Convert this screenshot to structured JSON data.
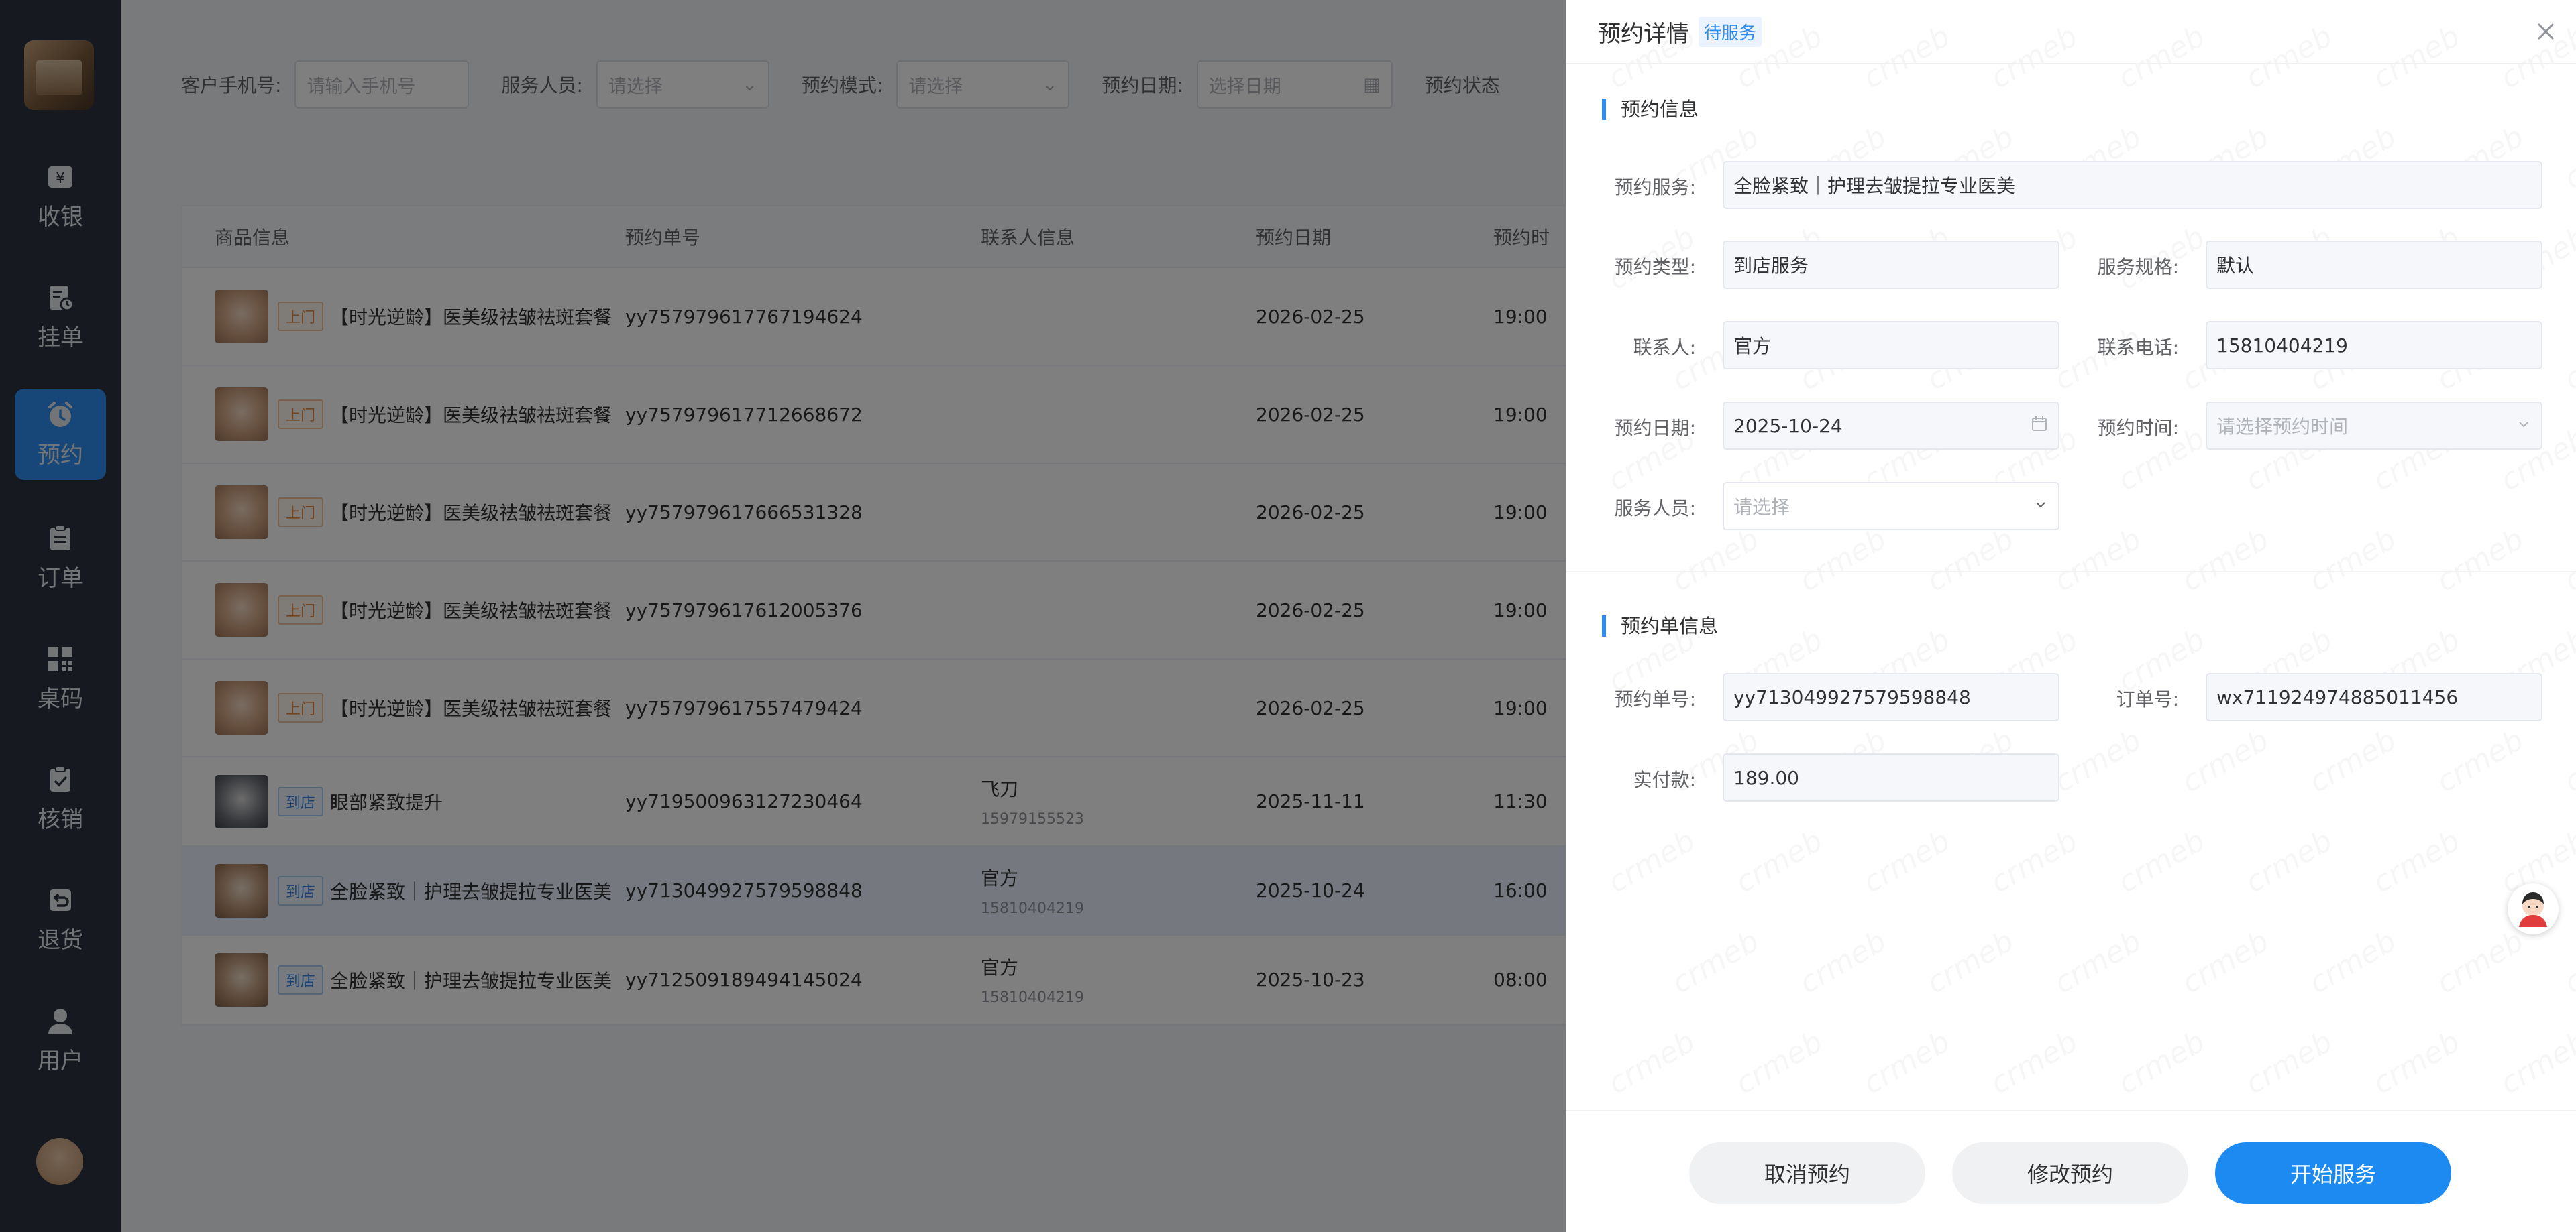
{
  "sidebar": {
    "items": [
      {
        "label": "收银",
        "icon": "cashier-icon"
      },
      {
        "label": "挂单",
        "icon": "pending-order-icon"
      },
      {
        "label": "预约",
        "icon": "alarm-clock-icon"
      },
      {
        "label": "订单",
        "icon": "clipboard-icon"
      },
      {
        "label": "桌码",
        "icon": "qr-code-icon"
      },
      {
        "label": "核销",
        "icon": "verify-icon"
      },
      {
        "label": "退货",
        "icon": "return-icon"
      },
      {
        "label": "用户",
        "icon": "user-icon"
      }
    ],
    "active": "预约"
  },
  "filters": {
    "phone_label": "客户手机号:",
    "phone_placeholder": "请输入手机号",
    "staff_label": "服务人员:",
    "staff_placeholder": "请选择",
    "mode_label": "预约模式:",
    "mode_placeholder": "请选择",
    "date_label": "预约日期:",
    "date_placeholder": "选择日期",
    "status_label": "预约状态"
  },
  "table": {
    "headers": {
      "goods": "商品信息",
      "order_no": "预约单号",
      "contact": "联系人信息",
      "date": "预约日期",
      "time": "预约时"
    },
    "rows": [
      {
        "tag": "上门",
        "goods": "【时光逆龄】医美级祛皱祛斑套餐",
        "order_no": "yy757979617767194624",
        "contact_name": "",
        "contact_phone": "",
        "date": "2026-02-25",
        "time": "19:00"
      },
      {
        "tag": "上门",
        "goods": "【时光逆龄】医美级祛皱祛斑套餐",
        "order_no": "yy757979617712668672",
        "contact_name": "",
        "contact_phone": "",
        "date": "2026-02-25",
        "time": "19:00"
      },
      {
        "tag": "上门",
        "goods": "【时光逆龄】医美级祛皱祛斑套餐",
        "order_no": "yy757979617666531328",
        "contact_name": "",
        "contact_phone": "",
        "date": "2026-02-25",
        "time": "19:00"
      },
      {
        "tag": "上门",
        "goods": "【时光逆龄】医美级祛皱祛斑套餐",
        "order_no": "yy757979617612005376",
        "contact_name": "",
        "contact_phone": "",
        "date": "2026-02-25",
        "time": "19:00"
      },
      {
        "tag": "上门",
        "goods": "【时光逆龄】医美级祛皱祛斑套餐",
        "order_no": "yy757979617557479424",
        "contact_name": "",
        "contact_phone": "",
        "date": "2026-02-25",
        "time": "19:00"
      },
      {
        "tag": "到店",
        "goods": "眼部紧致提升",
        "order_no": "yy719500963127230464",
        "contact_name": "飞刀",
        "contact_phone": "15979155523",
        "date": "2025-11-11",
        "time": "11:30"
      },
      {
        "tag": "到店",
        "goods": "全脸紧致｜护理去皱提拉专业医美",
        "order_no": "yy713049927579598848",
        "contact_name": "官方",
        "contact_phone": "15810404219",
        "date": "2025-10-24",
        "time": "16:00"
      },
      {
        "tag": "到店",
        "goods": "全脸紧致｜护理去皱提拉专业医美",
        "order_no": "yy712509189494145024",
        "contact_name": "官方",
        "contact_phone": "15810404219",
        "date": "2025-10-23",
        "time": "08:00"
      }
    ]
  },
  "drawer": {
    "title": "预约详情",
    "status": "待服务",
    "section1_title": "预约信息",
    "service_label": "预约服务:",
    "service_value": "全脸紧致｜护理去皱提拉专业医美",
    "type_label": "预约类型:",
    "type_value": "到店服务",
    "spec_label": "服务规格:",
    "spec_value": "默认",
    "contact_label": "联系人:",
    "contact_value": "官方",
    "phone_label": "联系电话:",
    "phone_value": "15810404219",
    "date_label": "预约日期:",
    "date_value": "2025-10-24",
    "time_label": "预约时间:",
    "time_placeholder": "请选择预约时间",
    "staff_label": "服务人员:",
    "staff_placeholder": "请选择",
    "section2_title": "预约单信息",
    "order_no_label": "预约单号:",
    "order_no_value": "yy713049927579598848",
    "trade_no_label": "订单号:",
    "trade_no_value": "wx711924974885011456",
    "paid_label": "实付款:",
    "paid_value": "189.00",
    "cancel_button": "取消预约",
    "modify_button": "修改预约",
    "start_button": "开始服务",
    "watermark": "crmeb"
  },
  "colors": {
    "accent": "#1d8af2",
    "sidebar_bg": "#2c3440",
    "tag_home": "#e88a3a",
    "tag_store": "#3a86e8"
  }
}
